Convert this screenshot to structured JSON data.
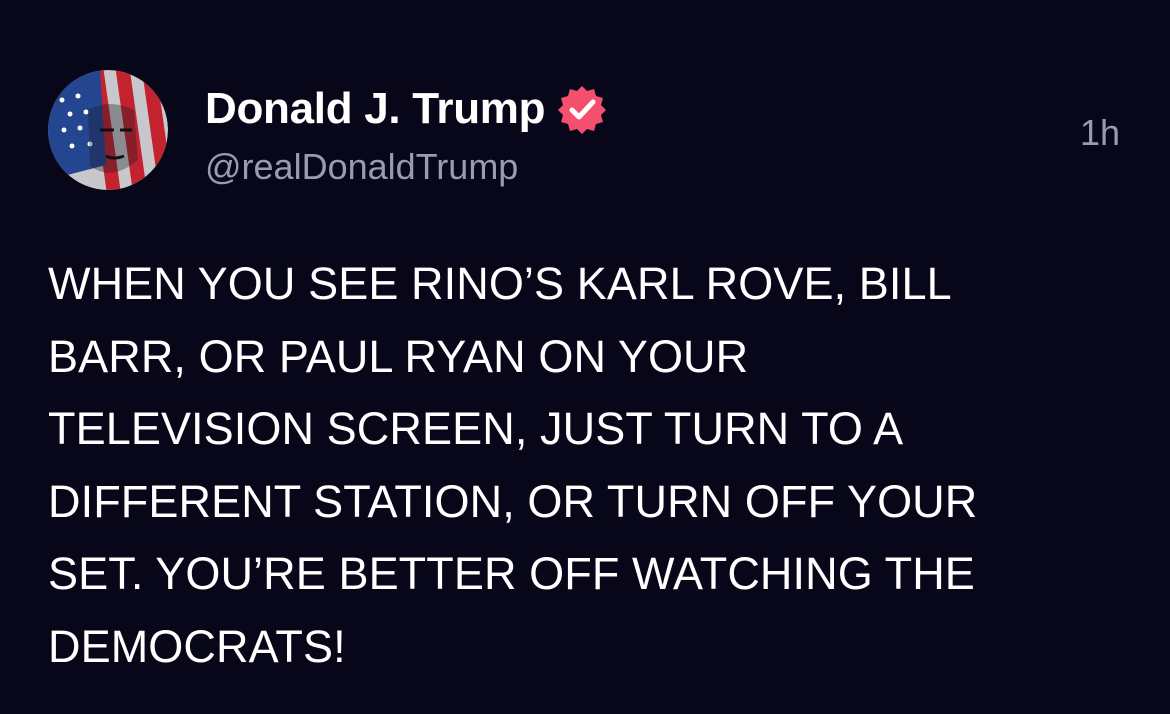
{
  "post": {
    "author": {
      "display_name": "Donald J. Trump",
      "handle": "@realDonaldTrump",
      "verified_icon": "verified-badge-icon",
      "avatar_icon": "profile-avatar"
    },
    "timestamp": "1h",
    "body_lines": [
      "WHEN YOU SEE RINO’S KARL ROVE, BILL",
      "BARR, OR PAUL RYAN ON YOUR",
      "TELEVISION SCREEN, JUST TURN TO A",
      "DIFFERENT STATION, OR TURN OFF YOUR",
      "SET. YOU’RE BETTER OFF WATCHING THE",
      "DEMOCRATS!"
    ]
  },
  "colors": {
    "background": "#08071a",
    "text_primary": "#ffffff",
    "text_secondary": "#9b9aae",
    "verified_badge": "#f4506e"
  }
}
